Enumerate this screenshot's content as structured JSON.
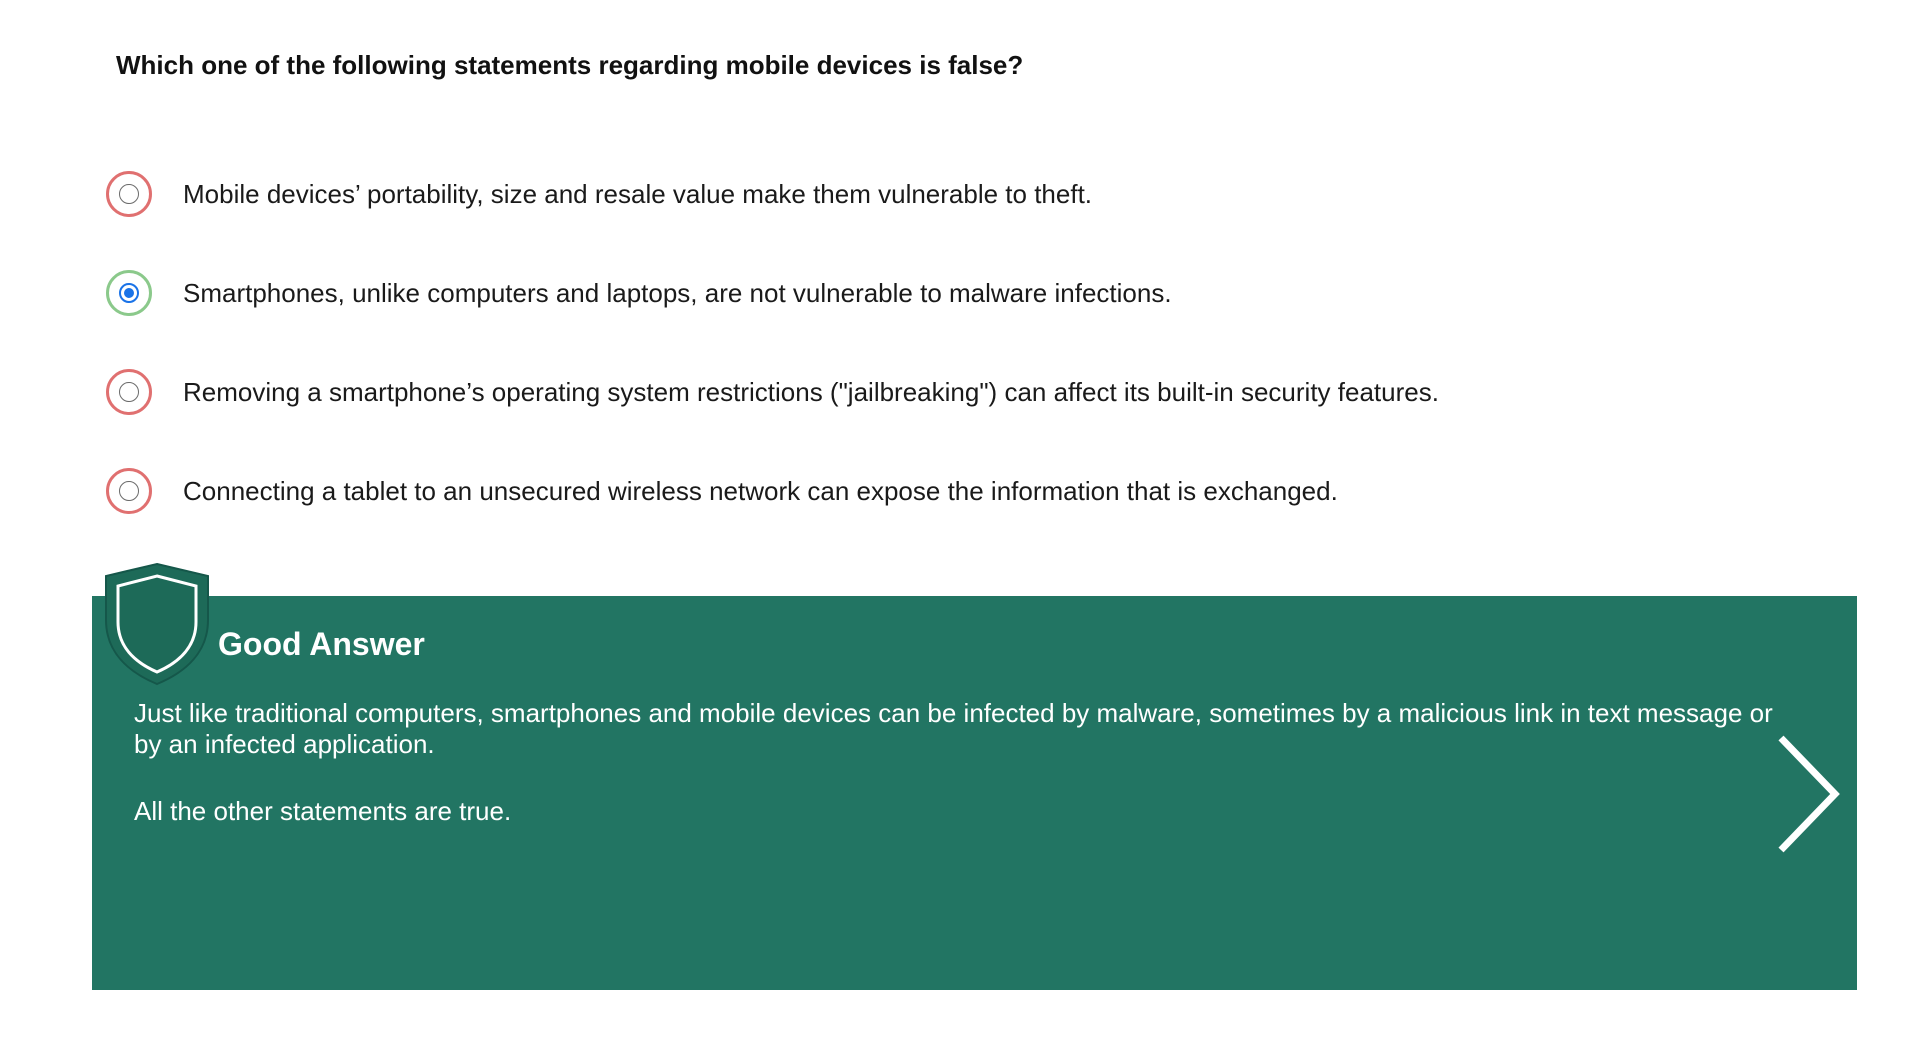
{
  "question": {
    "text": "Which one of the following statements regarding mobile devices is false?"
  },
  "options": [
    {
      "label": "Mobile devices’ portability, size and resale value make them vulnerable to theft.",
      "selected": false,
      "status": "incorrect"
    },
    {
      "label": "Smartphones, unlike computers and laptops, are not vulnerable to malware infections.",
      "selected": true,
      "status": "correct"
    },
    {
      "label": "Removing a smartphone’s operating system restrictions (\"jailbreaking\") can affect its built-in security features.",
      "selected": false,
      "status": "incorrect"
    },
    {
      "label": "Connecting a tablet to an unsecured wireless network can expose the information that is exchanged.",
      "selected": false,
      "status": "incorrect"
    }
  ],
  "feedback": {
    "title": "Good Answer",
    "paragraph_1": "Just like traditional computers, smartphones and mobile devices can be infected by malware, sometimes by a malicious link in text message or by an infected application.",
    "paragraph_2": "All the other statements are true.",
    "icon": "shield-icon",
    "next_icon": "chevron-right-icon"
  },
  "colors": {
    "feedback_background": "#227563",
    "correct_ring": "#8bc98b",
    "incorrect_ring": "#e07070",
    "radio_selected": "#1a73e8"
  }
}
